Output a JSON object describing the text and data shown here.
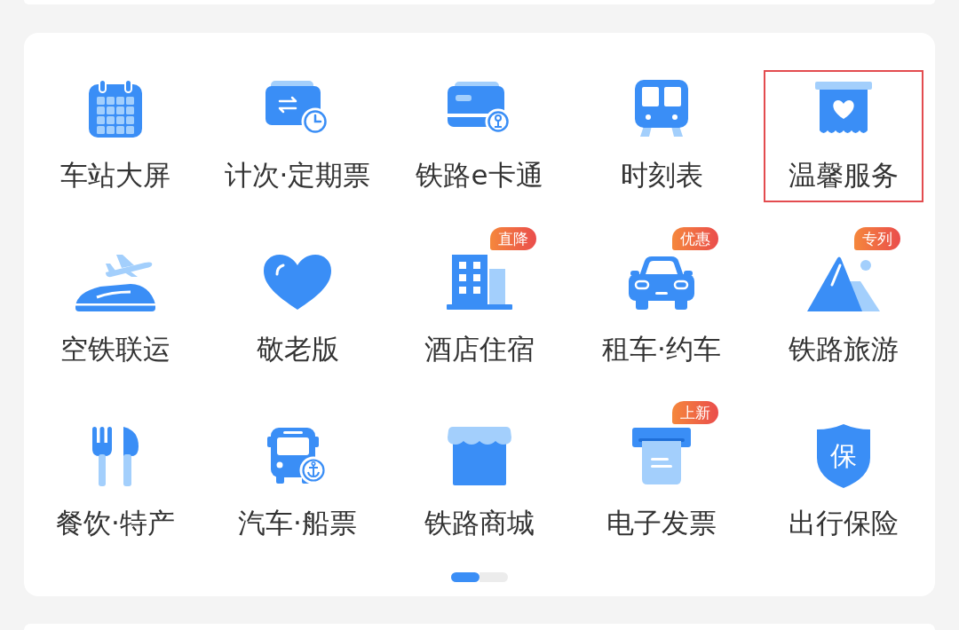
{
  "service_grid": {
    "items": [
      {
        "label": "车站大屏",
        "highlighted": false
      },
      {
        "label": "计次·定期票",
        "highlighted": false
      },
      {
        "label": "铁路e卡通",
        "highlighted": false
      },
      {
        "label": "时刻表",
        "highlighted": false
      },
      {
        "label": "温馨服务",
        "highlighted": true
      },
      {
        "label": "空铁联运",
        "highlighted": false
      },
      {
        "label": "敬老版",
        "highlighted": false
      },
      {
        "label": "酒店住宿",
        "badge": "直降",
        "highlighted": false
      },
      {
        "label": "租车·约车",
        "badge": "优惠",
        "highlighted": false
      },
      {
        "label": "铁路旅游",
        "badge": "专列",
        "highlighted": false
      },
      {
        "label": "餐饮·特产",
        "highlighted": false
      },
      {
        "label": "汽车·船票",
        "highlighted": false
      },
      {
        "label": "铁路商城",
        "highlighted": false
      },
      {
        "label": "电子发票",
        "badge": "上新",
        "highlighted": false
      },
      {
        "label": "出行保险",
        "icon_text": "保",
        "highlighted": false
      }
    ],
    "pages": [
      {
        "selected": true
      },
      {
        "selected": false
      }
    ]
  }
}
